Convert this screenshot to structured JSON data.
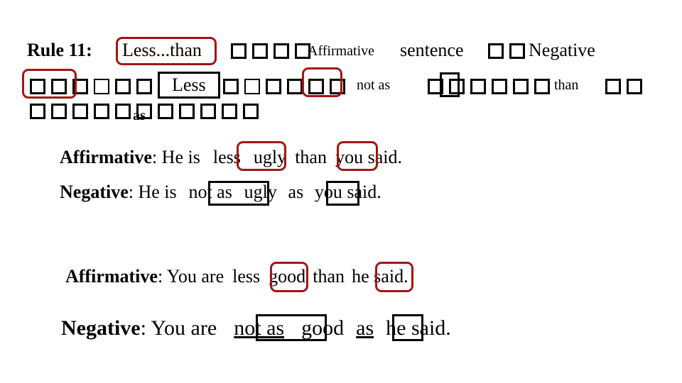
{
  "slide": {
    "rule": {
      "label": "Rule 11:",
      "keyword": "Less...than",
      "affirmative_word": "Affirmative",
      "sentence_word": "sentence",
      "negative_word": "Negative",
      "less_word": "Less",
      "not_as": "not as",
      "than_word": "than",
      "as_word": "as",
      "missing_glyph_note": "unrenderable characters shown as boxes"
    },
    "examples": [
      {
        "affirmative_label": "Affirmative",
        "affirmative_parts": [
          "He is",
          "less",
          "ugly",
          "than",
          "you said."
        ],
        "negative_label": "Negative",
        "negative_parts": [
          "He is",
          "not as",
          "ugly",
          "as",
          "you said."
        ]
      },
      {
        "affirmative_label": "Affirmative",
        "affirmative_parts": [
          "You are",
          "less",
          "good",
          "than",
          "he said."
        ],
        "negative_label": "Negative",
        "negative_parts": [
          "You are",
          "not as",
          "good",
          "as",
          "he said."
        ]
      }
    ],
    "colors": {
      "highlight_red": "#a31515",
      "highlight_black": "#000000",
      "text": "#000000",
      "background": "#ffffff"
    }
  }
}
